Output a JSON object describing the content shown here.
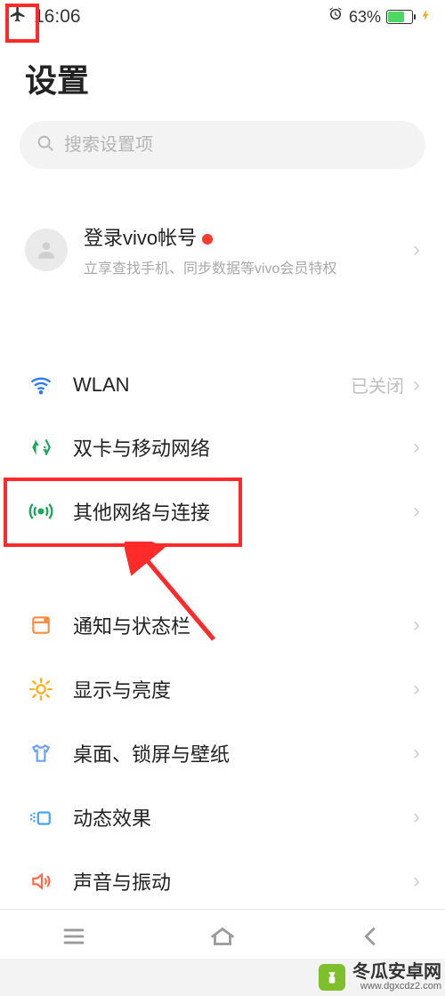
{
  "statusbar": {
    "time": "16:06",
    "battery_pct": "63%"
  },
  "page_title": "设置",
  "search": {
    "placeholder": "搜索设置项"
  },
  "account": {
    "title": "登录vivo帐号",
    "subtitle": "立享查找手机、同步数据等vivo会员特权"
  },
  "group_network": {
    "wlan": {
      "label": "WLAN",
      "value": "已关闭"
    },
    "sim": {
      "label": "双卡与移动网络"
    },
    "other": {
      "label": "其他网络与连接"
    }
  },
  "group_display": {
    "notif": {
      "label": "通知与状态栏"
    },
    "bright": {
      "label": "显示与亮度"
    },
    "desktop": {
      "label": "桌面、锁屏与壁纸"
    },
    "anim": {
      "label": "动态效果"
    },
    "sound": {
      "label": "声音与振动"
    }
  },
  "watermark": {
    "text": "冬瓜安卓网",
    "url": "www.dgxcdz2.com"
  }
}
